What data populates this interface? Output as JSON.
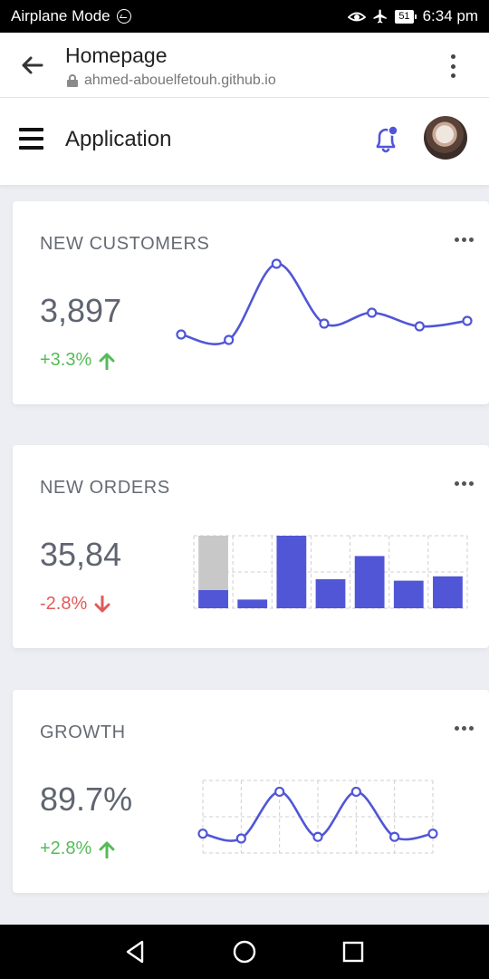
{
  "status_bar": {
    "left_text": "Airplane Mode",
    "battery": "51",
    "time": "6:34 pm"
  },
  "browser": {
    "title": "Homepage",
    "url": "ahmed-abouelfetouh.github.io"
  },
  "app": {
    "title": "Application"
  },
  "cards": [
    {
      "title": "NEW CUSTOMERS",
      "value": "3,897",
      "change": "+3.3%",
      "trend": "up"
    },
    {
      "title": "NEW ORDERS",
      "value": "35,84",
      "change": "-2.8%",
      "trend": "down"
    },
    {
      "title": "GROWTH",
      "value": "89.7%",
      "change": "+2.8%",
      "trend": "up"
    }
  ],
  "colors": {
    "accent": "#5056d6",
    "up": "#56bb58",
    "down": "#e05a5a",
    "muted_bar": "#c8c8c8"
  },
  "chart_data": [
    {
      "type": "line",
      "values": [
        1.1,
        0.9,
        3.7,
        1.5,
        1.9,
        1.4,
        1.6
      ],
      "ylim": [
        0,
        4
      ],
      "grid": false
    },
    {
      "type": "bar",
      "values": [
        25,
        12,
        100,
        40,
        72,
        38,
        44
      ],
      "background_values": [
        100,
        0,
        0,
        0,
        0,
        0,
        0
      ],
      "ylim": [
        0,
        100
      ],
      "grid": true
    },
    {
      "type": "line",
      "values": [
        1.2,
        0.9,
        3.8,
        1.0,
        3.8,
        1.0,
        1.2
      ],
      "ylim": [
        0,
        4.5
      ],
      "grid": true
    }
  ]
}
